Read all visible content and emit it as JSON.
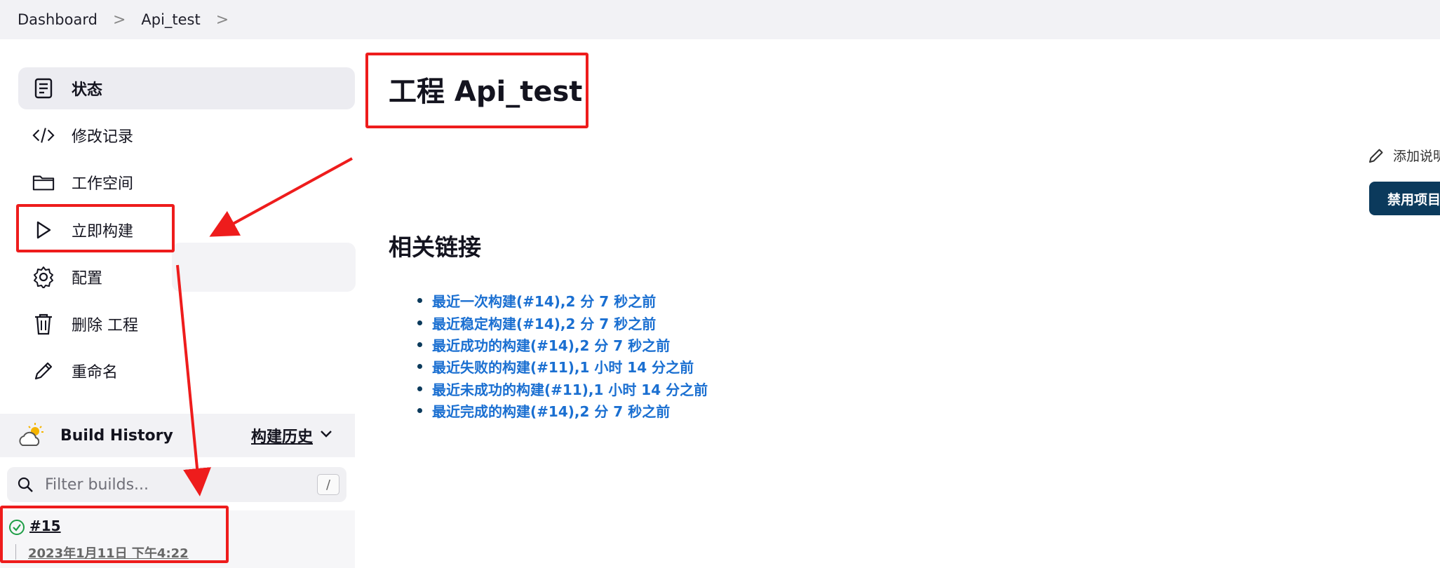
{
  "breadcrumb": {
    "items": [
      "Dashboard",
      "Api_test"
    ],
    "separator": ">"
  },
  "sidebar": {
    "tasks": [
      {
        "label": "状态",
        "icon": "status-document-icon",
        "active": true
      },
      {
        "label": "修改记录",
        "icon": "code-icon"
      },
      {
        "label": "工作空间",
        "icon": "folder-icon"
      },
      {
        "label": "立即构建",
        "icon": "play-icon"
      },
      {
        "label": "配置",
        "icon": "gear-icon"
      },
      {
        "label": "删除 工程",
        "icon": "trash-icon"
      },
      {
        "label": "重命名",
        "icon": "pencil-icon"
      }
    ]
  },
  "build_history": {
    "title": "Build History",
    "trend_label": "构建历史",
    "filter_placeholder": "Filter builds...",
    "filter_shortcut": "/",
    "builds": [
      {
        "number": "#15",
        "time": "2023年1月11日 下午4:22",
        "status": "success"
      }
    ]
  },
  "main": {
    "title": "工程 Api_test",
    "add_description": "添加说明",
    "disable_button": "禁用项目",
    "related_links_title": "相关链接",
    "related_links": [
      "最近一次构建(#14),2 分 7 秒之前",
      "最近稳定构建(#14),2 分 7 秒之前",
      "最近成功的构建(#14),2 分 7 秒之前",
      "最近失败的构建(#11),1 小时 14 分之前",
      "最近未成功的构建(#11),1 小时 14 分之前",
      "最近完成的构建(#14),2 分 7 秒之前"
    ]
  },
  "colors": {
    "annotation": "#ee1c1c",
    "link": "#1a6fd1",
    "primary_button": "#0b3a5c",
    "success": "#1e9e46"
  }
}
